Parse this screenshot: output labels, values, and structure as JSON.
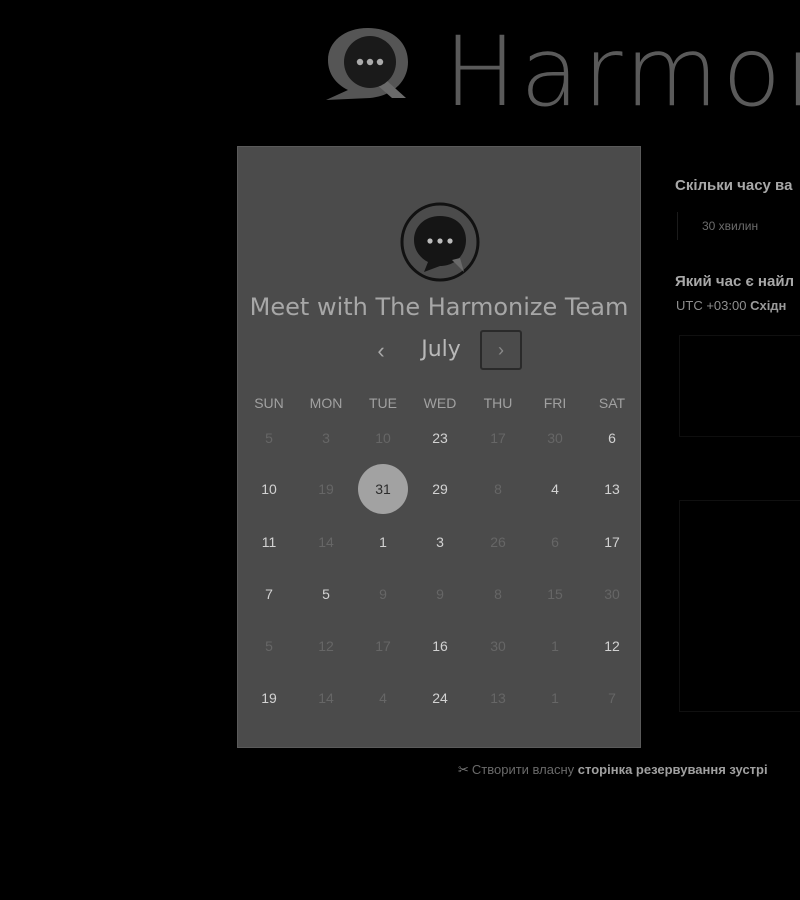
{
  "header": {
    "brand_name": "Harmonize"
  },
  "calendar": {
    "title": "Meet with The Harmonize Team",
    "month": "July",
    "prev_label": "‹",
    "next_label": "›",
    "weekdays": [
      "SUN",
      "MON",
      "TUE",
      "WED",
      "THU",
      "FRI",
      "SAT"
    ],
    "weeks": [
      [
        {
          "d": "5",
          "a": false
        },
        {
          "d": "3",
          "a": false
        },
        {
          "d": "10",
          "a": false
        },
        {
          "d": "23",
          "a": true
        },
        {
          "d": "17",
          "a": false
        },
        {
          "d": "30",
          "a": false
        },
        {
          "d": "6",
          "a": true
        }
      ],
      [
        {
          "d": "10",
          "a": true
        },
        {
          "d": "19",
          "a": false
        },
        {
          "d": "31",
          "a": true,
          "selected": true
        },
        {
          "d": "29",
          "a": true
        },
        {
          "d": "8",
          "a": false
        },
        {
          "d": "4",
          "a": true
        },
        {
          "d": "13",
          "a": true
        }
      ],
      [
        {
          "d": "11",
          "a": true
        },
        {
          "d": "14",
          "a": false
        },
        {
          "d": "1",
          "a": true
        },
        {
          "d": "3",
          "a": true
        },
        {
          "d": "26",
          "a": false
        },
        {
          "d": "6",
          "a": false
        },
        {
          "d": "17",
          "a": true
        }
      ],
      [
        {
          "d": "7",
          "a": true
        },
        {
          "d": "5",
          "a": true
        },
        {
          "d": "9",
          "a": false
        },
        {
          "d": "9",
          "a": false
        },
        {
          "d": "8",
          "a": false
        },
        {
          "d": "15",
          "a": false
        },
        {
          "d": "30",
          "a": false
        }
      ],
      [
        {
          "d": "5",
          "a": false
        },
        {
          "d": "12",
          "a": false
        },
        {
          "d": "17",
          "a": false
        },
        {
          "d": "16",
          "a": true
        },
        {
          "d": "30",
          "a": false
        },
        {
          "d": "1",
          "a": false
        },
        {
          "d": "12",
          "a": true
        }
      ],
      [
        {
          "d": "19",
          "a": true
        },
        {
          "d": "14",
          "a": false
        },
        {
          "d": "4",
          "a": false
        },
        {
          "d": "24",
          "a": true
        },
        {
          "d": "13",
          "a": false
        },
        {
          "d": "1",
          "a": false
        },
        {
          "d": "7",
          "a": false
        }
      ]
    ]
  },
  "details": {
    "duration_question": "Скільки часу ва",
    "duration_option": "30 хвилин",
    "time_question": "Який час є найл",
    "timezone_prefix": "UTC +03:00",
    "timezone_name": "Східн"
  },
  "footer": {
    "icon": "scissors-icon",
    "text": "Створити власну",
    "bold": "сторінка резервування зустрі"
  },
  "colors": {
    "background": "#000000",
    "panel": "#4b4b4b",
    "selected_day": "#a2a2a2"
  }
}
